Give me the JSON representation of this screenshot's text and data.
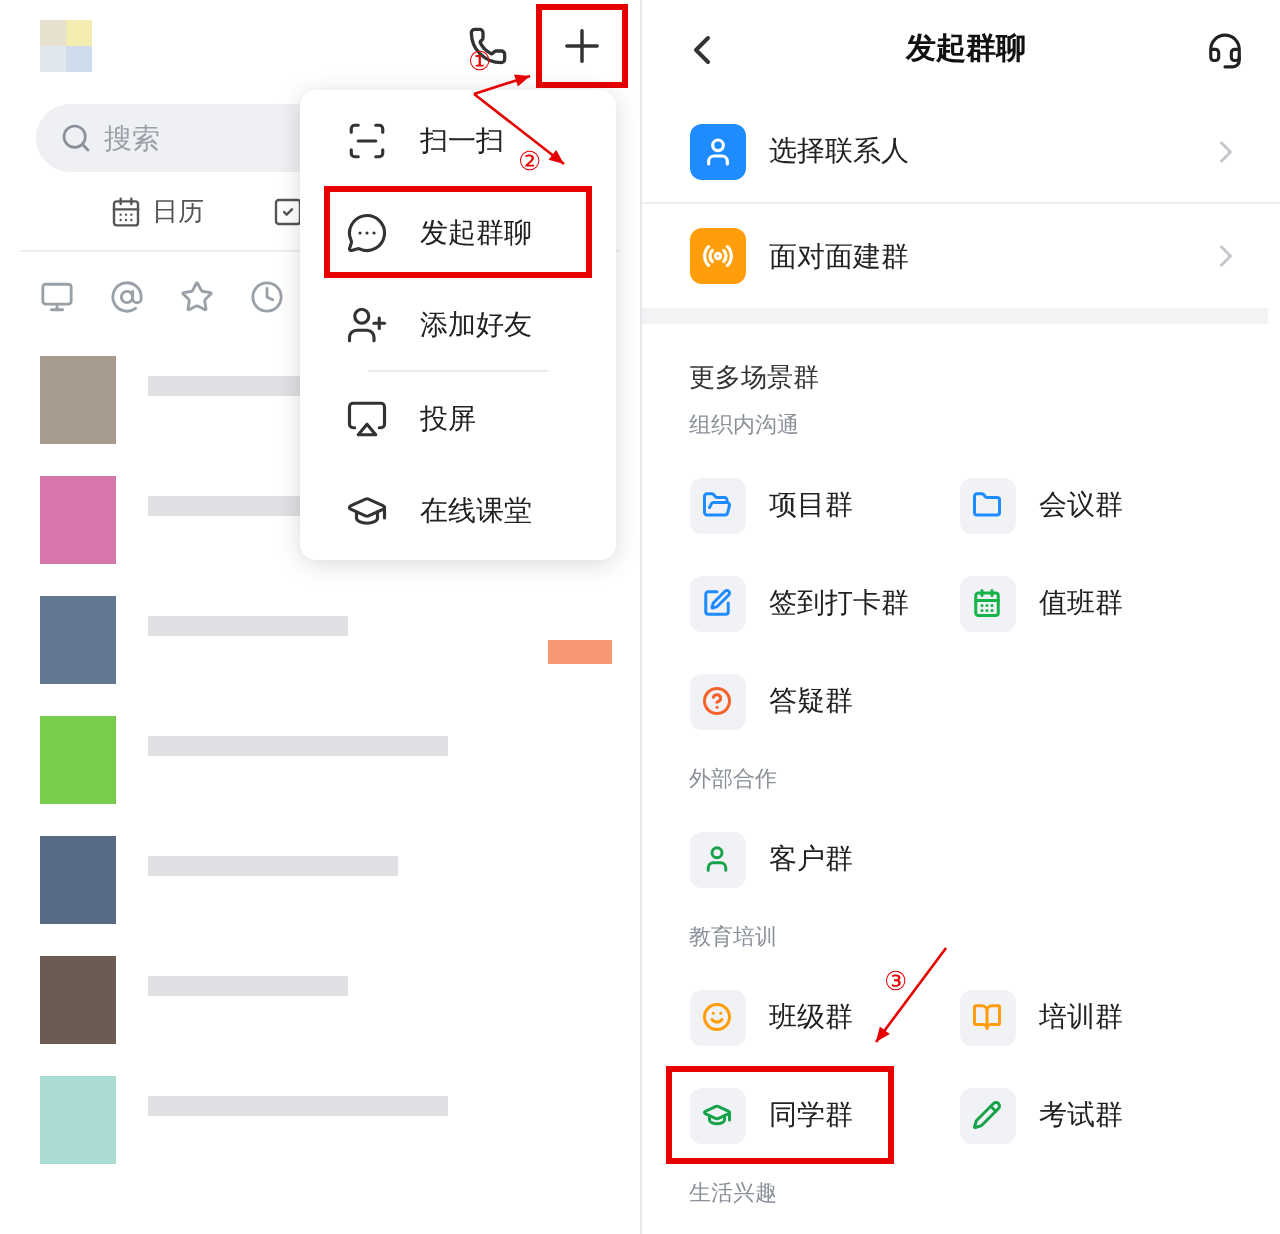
{
  "left_screen": {
    "plus_button": {
      "annotated": true
    },
    "search": {
      "placeholder": "搜索"
    },
    "shortcuts": [
      {
        "label": "日历",
        "kind": "calendar"
      },
      {
        "kind": "check"
      }
    ],
    "menu": {
      "items": [
        {
          "label": "扫一扫",
          "kind": "scan",
          "annotated": false,
          "divider_after": false
        },
        {
          "label": "发起群聊",
          "kind": "chat",
          "annotated": true,
          "divider_after": false
        },
        {
          "label": "添加好友",
          "kind": "add-user",
          "annotated": false,
          "divider_after": true
        },
        {
          "label": "投屏",
          "kind": "cast",
          "annotated": false,
          "divider_after": false
        },
        {
          "label": "在线课堂",
          "kind": "cap",
          "annotated": false,
          "divider_after": false
        }
      ]
    }
  },
  "right_screen": {
    "title": "发起群聊",
    "entries": [
      {
        "label": "选择联系人",
        "kind": "user",
        "color": "#1e8cff"
      },
      {
        "label": "面对面建群",
        "kind": "signal",
        "color": "#ff9d0a"
      }
    ],
    "more_title": "更多场景群",
    "sections": [
      {
        "title": "组织内沟通",
        "groups": [
          {
            "label": "项目群",
            "kind": "folder-people",
            "color": "#1e8cff",
            "annotated": false
          },
          {
            "label": "会议群",
            "kind": "folder",
            "color": "#1e8cff",
            "annotated": false
          },
          {
            "label": "签到打卡群",
            "kind": "edit",
            "color": "#1e8cff",
            "annotated": false
          },
          {
            "label": "值班群",
            "kind": "calendar",
            "color": "#16b34a",
            "annotated": false
          },
          {
            "label": "答疑群",
            "kind": "question",
            "color": "#f4622a",
            "annotated": false
          }
        ]
      },
      {
        "title": "外部合作",
        "groups": [
          {
            "label": "客户群",
            "kind": "user",
            "color": "#16a34a",
            "annotated": false
          }
        ]
      },
      {
        "title": "教育培训",
        "groups": [
          {
            "label": "班级群",
            "kind": "smile",
            "color": "#ff9d0a",
            "annotated": false
          },
          {
            "label": "培训群",
            "kind": "book",
            "color": "#ff9d0a",
            "annotated": false
          },
          {
            "label": "同学群",
            "kind": "cap",
            "color": "#16a34a",
            "annotated": true
          },
          {
            "label": "考试群",
            "kind": "pencil",
            "color": "#16a34a",
            "annotated": false
          }
        ]
      },
      {
        "title": "生活兴趣"
      }
    ]
  },
  "annotations": [
    {
      "text": "①"
    },
    {
      "text": "②"
    },
    {
      "text": "③"
    }
  ]
}
